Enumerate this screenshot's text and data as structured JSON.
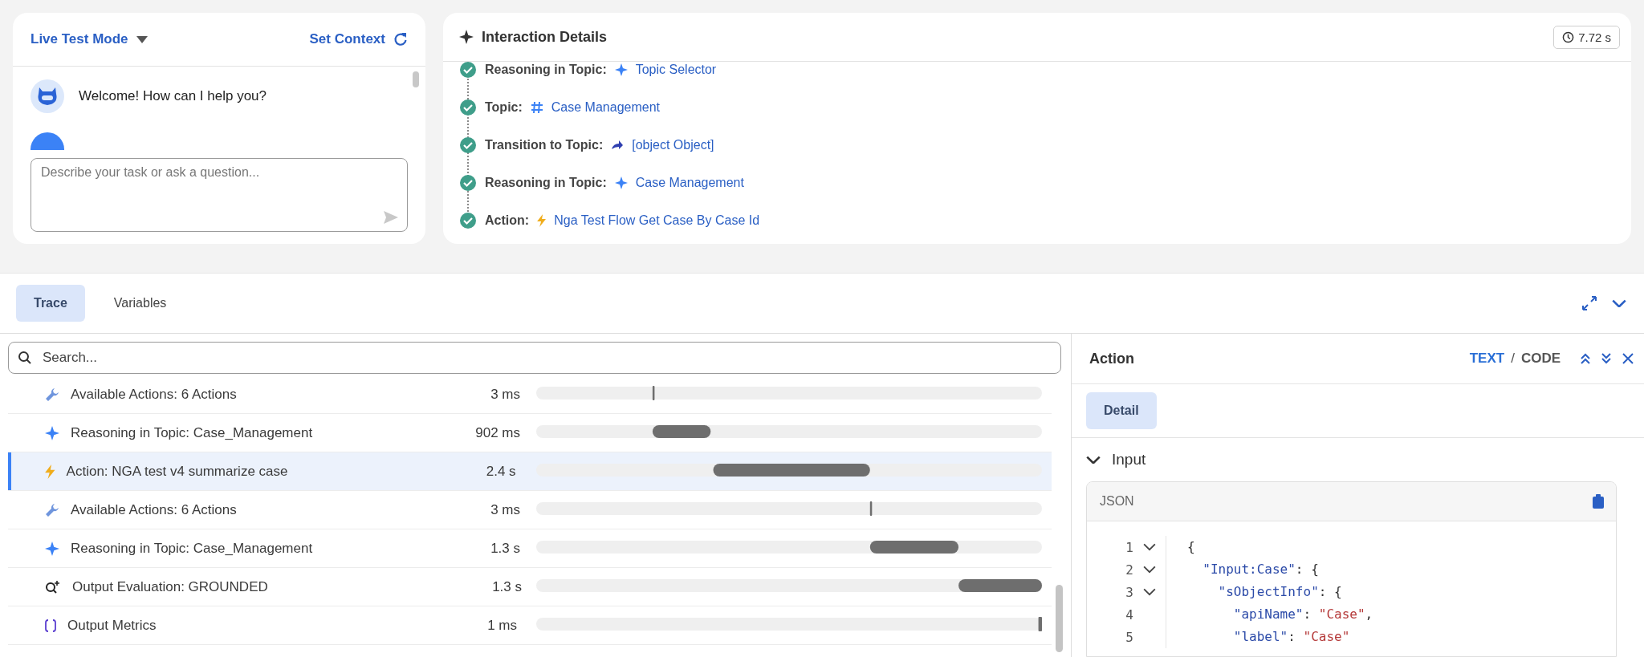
{
  "chat": {
    "mode": "Live Test Mode",
    "context_link": "Set Context",
    "messages": [
      {
        "kind": "agent",
        "text": "Welcome! How can I help you?"
      }
    ],
    "input": {
      "placeholder": "Describe your task or ask a question..."
    }
  },
  "interaction_details": {
    "title": "Interaction Details",
    "duration": "7.72 s",
    "steps": [
      {
        "label": "Reasoning in Topic:",
        "kind": "reasoning",
        "value": "Topic Selector",
        "done": true
      },
      {
        "label": "Topic:",
        "kind": "topic",
        "value": "Case Management",
        "done": true
      },
      {
        "label": "Transition to Topic:",
        "kind": "transition",
        "value": "[object Object]",
        "done": true
      },
      {
        "label": "Reasoning in Topic:",
        "kind": "reasoning",
        "value": "Case Management",
        "done": true
      },
      {
        "label": "Action:",
        "kind": "action",
        "value": "Nga Test Flow Get Case By Case Id",
        "done": true
      }
    ]
  },
  "bottom_tabs": [
    {
      "label": "Trace",
      "selected": true
    },
    {
      "label": "Variables",
      "selected": false
    }
  ],
  "trace": {
    "search": {
      "placeholder": "Search..."
    },
    "rows": [
      {
        "kind": "actions",
        "label": "Available Actions: 6 Actions",
        "duration": "3 ms",
        "selected": false
      },
      {
        "kind": "reasoning",
        "label": "Reasoning in Topic: Case_Management",
        "duration": "902 ms",
        "selected": false
      },
      {
        "kind": "action",
        "label": "Action: NGA test v4 summarize case",
        "duration": "2.4 s",
        "selected": true
      },
      {
        "kind": "actions",
        "label": "Available Actions: 6 Actions",
        "duration": "3 ms",
        "selected": false
      },
      {
        "kind": "reasoning",
        "label": "Reasoning in Topic: Case_Management",
        "duration": "1.3 s",
        "selected": false
      },
      {
        "kind": "evaluation",
        "label": "Output Evaluation: GROUNDED",
        "duration": "1.3 s",
        "selected": false
      },
      {
        "kind": "metrics",
        "label": "Output Metrics",
        "duration": "1 ms",
        "selected": false
      }
    ]
  },
  "detail_panel": {
    "title": "Action",
    "view_options": [
      {
        "label": "TEXT",
        "selected": true
      },
      {
        "label": "CODE",
        "selected": false
      }
    ],
    "separator": "/",
    "tabs": [
      {
        "label": "Detail",
        "selected": true
      }
    ],
    "section": {
      "title": "Input",
      "expanded": true
    },
    "code_block": {
      "language": "JSON",
      "lines": [
        {
          "number": "1",
          "foldable": true,
          "text": "{"
        },
        {
          "number": "2",
          "foldable": true,
          "text": "  \"Input:Case\": {"
        },
        {
          "number": "3",
          "foldable": true,
          "text": "    \"sObjectInfo\": {"
        },
        {
          "number": "4",
          "foldable": false,
          "text": "      \"apiName\": \"Case\","
        },
        {
          "number": "5",
          "foldable": false,
          "text": "      \"label\": \"Case\""
        }
      ]
    }
  }
}
